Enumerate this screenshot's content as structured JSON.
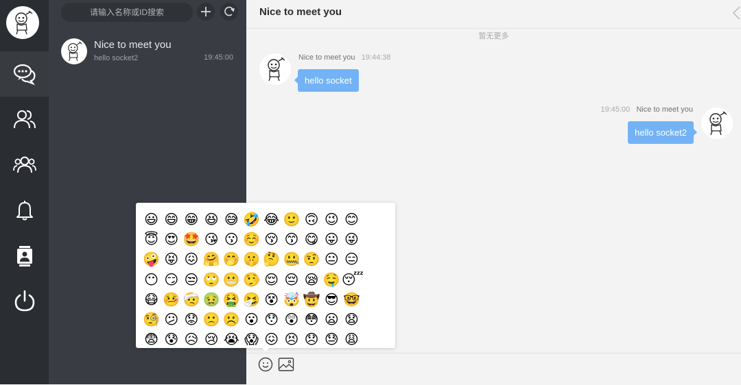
{
  "sidebar": {
    "items": [
      {
        "name": "messages",
        "icon": "chat-bubbles-icon",
        "active": true
      },
      {
        "name": "contacts",
        "icon": "user-pair-icon",
        "active": false
      },
      {
        "name": "groups",
        "icon": "user-group-icon",
        "active": false
      },
      {
        "name": "notifications",
        "icon": "bell-icon",
        "active": false
      },
      {
        "name": "address-book",
        "icon": "contact-card-icon",
        "active": false
      },
      {
        "name": "logout",
        "icon": "power-icon",
        "active": false
      }
    ]
  },
  "list": {
    "search_placeholder": "请输入名称或ID搜索",
    "add_icon": "plus-icon",
    "refresh_icon": "refresh-icon",
    "conversations": [
      {
        "name": "Nice to meet you",
        "last_message": "hello socket2",
        "time": "19:45:00"
      }
    ]
  },
  "chat": {
    "title": "Nice to meet you",
    "no_more": "暂无更多",
    "messages": [
      {
        "side": "left",
        "sender": "Nice to meet you",
        "time": "19:44:38",
        "text": "hello socket"
      },
      {
        "side": "right",
        "sender": "Nice to meet you",
        "time": "19:45:00",
        "text": "hello socket2"
      }
    ],
    "composer": {
      "emoji_icon": "smiley-icon",
      "image_icon": "image-icon"
    }
  },
  "emoji_panel": {
    "emojis": [
      "😃",
      "😄",
      "😁",
      "😆",
      "😅",
      "🤣",
      "😂",
      "🙂",
      "🙃",
      "😉",
      "😊",
      "😇",
      "😍",
      "🤩",
      "😘",
      "😗",
      "☺️",
      "😚",
      "😙",
      "😋",
      "😛",
      "😜",
      "🤪",
      "😝",
      "😖",
      "🤗",
      "🤭",
      "🤫",
      "🤔",
      "🤐",
      "🤨",
      "😐",
      "😑",
      "😶",
      "😏",
      "😒",
      "🙄",
      "😬",
      "🤥",
      "😌",
      "😔",
      "😪",
      "🤤",
      "😴",
      "😷",
      "🤒",
      "🤕",
      "🤢",
      "🤮",
      "🤧",
      "😵",
      "🤯",
      "🤠",
      "😎",
      "🤓",
      "🧐",
      "😕",
      "😟",
      "🙁",
      "☹️",
      "😮",
      "😯",
      "😲",
      "😳",
      "😦",
      "😧",
      "😨",
      "😰",
      "😥",
      "😢",
      "😭",
      "😱",
      "😖",
      "😣",
      "😞",
      "😓",
      "😩"
    ]
  },
  "colors": {
    "nav_bg": "#2a2d31",
    "list_bg": "#393c42",
    "bubble": "#73b3f5",
    "chat_bg": "#f3f3f3"
  }
}
